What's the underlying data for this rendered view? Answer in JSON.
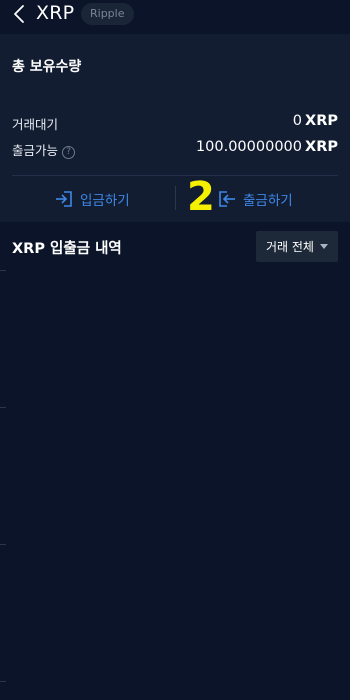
{
  "header": {
    "title": "XRP",
    "coin_name": "Ripple",
    "back_icon": "chevron-left-icon"
  },
  "holdings": {
    "title": "총 보유수량",
    "rows": [
      {
        "label": "거래대기",
        "amount": "0",
        "unit": "XRP"
      },
      {
        "label": "출금가능",
        "amount": "100.00000000",
        "unit": "XRP",
        "help_icon": "?"
      }
    ],
    "deposit_label": "입금하기",
    "withdraw_label": "출금하기",
    "annotation": "2"
  },
  "history": {
    "title": "XRP 입출금 내역",
    "filter_selected": "거래 전체"
  },
  "colors": {
    "background": "#0b1428",
    "card": "#121d31",
    "accent": "#3d87e8",
    "annotation": "#f4f000"
  }
}
